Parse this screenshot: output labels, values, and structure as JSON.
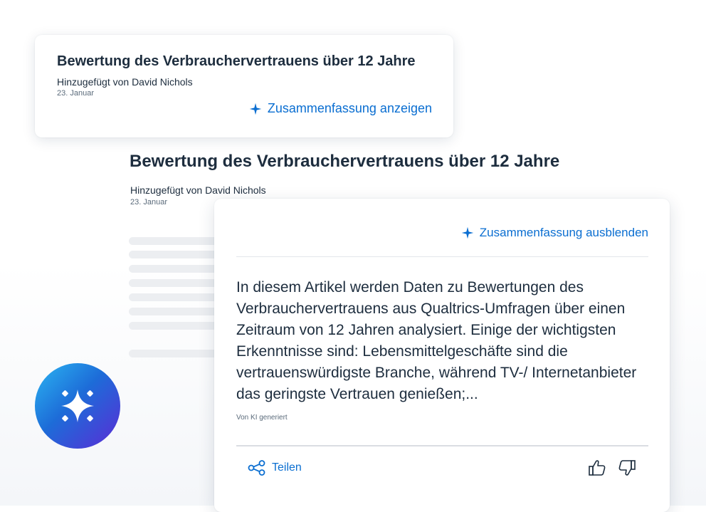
{
  "top_card": {
    "title": "Bewertung des Verbrauchervertrauens über 12 Jahre",
    "author": "Hinzugefügt von David Nichols",
    "date": "23. Januar",
    "show_summary_label": "Zusammenfassung anzeigen",
    "show_summary_icon": "sparkle-icon"
  },
  "article": {
    "title": "Bewertung des Verbrauchervertrauens über 12 Jahre",
    "author": "Hinzugefügt von David Nichols",
    "date": "23. Januar"
  },
  "summary_panel": {
    "hide_summary_label": "Zusammenfassung ausblenden",
    "hide_summary_icon": "sparkle-icon",
    "text": "In diesem Artikel werden Daten zu Bewertungen des Verbrauchervertrauens aus Qualtrics-Umfragen über einen Zeitraum von 12 Jahren analysiert. Einige der wichtigsten Erkenntnisse sind: Lebensmittelgeschäfte sind die vertrauenswürdigste Branche, während TV-/ Internetanbieter das geringste Vertrauen genießen;...",
    "ai_note": "Von KI generiert",
    "share_label": "Teilen",
    "share_icon": "share-icon",
    "thumbs_up_icon": "thumbs-up-icon",
    "thumbs_down_icon": "thumbs-down-icon"
  },
  "ai_badge": {
    "icon": "sparkle-icon"
  },
  "colors": {
    "accent": "#0a6ed1",
    "text": "#1d2d3e",
    "muted": "#5b6b7b"
  }
}
